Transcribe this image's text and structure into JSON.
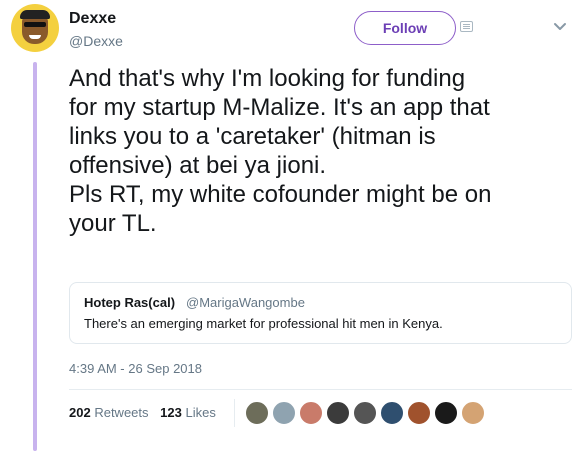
{
  "author": {
    "display_name": "Dexxe",
    "handle": "@Dexxe",
    "avatar_icon": "cartoon-avatar-icon"
  },
  "follow_label": "Follow",
  "tweet_text": "And that's why I'm looking for funding\nfor my startup M-Malize. It's an app that\nlinks you to a 'caretaker' (hitman is\noffensive) at bei ya jioni.\nPls RT, my white cofounder might be on\nyour TL.",
  "quoted_tweet": {
    "display_name": "Hotep Ras(cal)",
    "handle": "@MarigaWangombe",
    "text": "There's an emerging market for professional hit men in Kenya."
  },
  "timestamp": "4:39 AM - 26 Sep 2018",
  "stats": {
    "retweets_count": "202",
    "retweets_label": "Retweets",
    "likes_count": "123",
    "likes_label": "Likes"
  },
  "likers": [
    {
      "icon": "liker-avatar-icon",
      "color": "#6d6d5a"
    },
    {
      "icon": "liker-avatar-icon",
      "color": "#8fa3b0"
    },
    {
      "icon": "liker-avatar-icon",
      "color": "#c97b6a"
    },
    {
      "icon": "liker-avatar-icon",
      "color": "#3b3b3b"
    },
    {
      "icon": "liker-avatar-icon",
      "color": "#555555"
    },
    {
      "icon": "liker-avatar-icon",
      "color": "#2f4f6f"
    },
    {
      "icon": "liker-avatar-icon",
      "color": "#a0522d"
    },
    {
      "icon": "liker-avatar-icon",
      "color": "#1a1a1a"
    },
    {
      "icon": "liker-avatar-icon",
      "color": "#d4a373"
    }
  ],
  "colors": {
    "accent": "#6c3fb5",
    "thread_line": "#c8b3ee",
    "muted_text": "#657786",
    "avatar_bg": "#f4d03f"
  }
}
